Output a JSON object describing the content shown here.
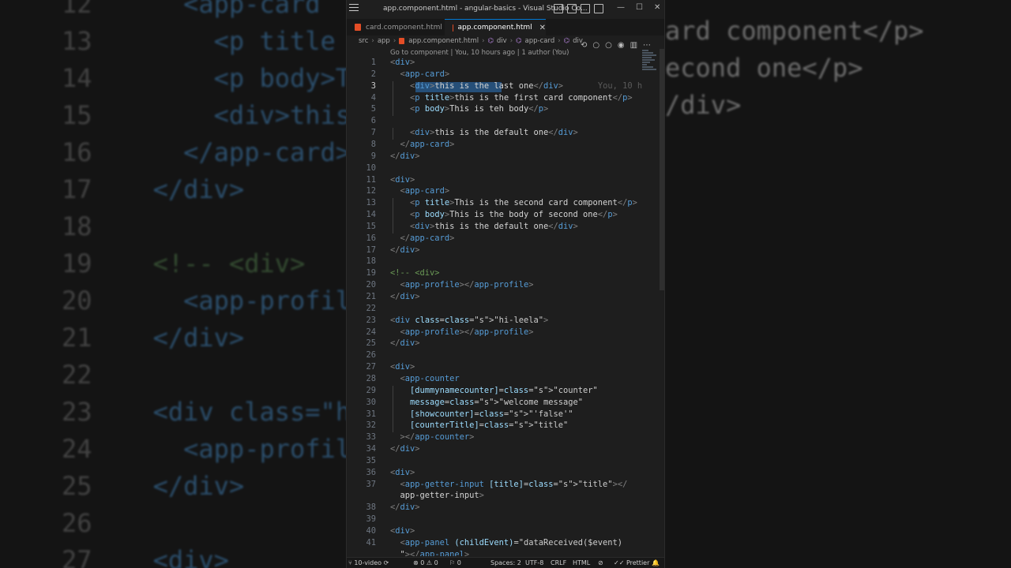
{
  "window": {
    "title": "app.component.html - angular-basics - Visual Studio Co..."
  },
  "tabs": [
    {
      "label": "card.component.html",
      "active": false
    },
    {
      "label": "app.component.html",
      "active": true
    }
  ],
  "breadcrumb": [
    "src",
    "app",
    "app.component.html",
    "div",
    "app-card",
    "div"
  ],
  "codelens": "Go to component | You, 10 hours ago | 1 author (You)",
  "blame": "You, 10 h",
  "lines": [
    {
      "n": "1",
      "code": "<div>"
    },
    {
      "n": "2",
      "code": "  <app-card>"
    },
    {
      "n": "3",
      "code": "    <div>this is the last one</div>"
    },
    {
      "n": "4",
      "code": "    <p title>this is the first card component</p>"
    },
    {
      "n": "5",
      "code": "    <p body>This is teh body</p>"
    },
    {
      "n": "6",
      "code": ""
    },
    {
      "n": "7",
      "code": "    <div>this is the default one</div>"
    },
    {
      "n": "8",
      "code": "  </app-card>"
    },
    {
      "n": "9",
      "code": "</div>"
    },
    {
      "n": "10",
      "code": ""
    },
    {
      "n": "11",
      "code": "<div>"
    },
    {
      "n": "12",
      "code": "  <app-card>"
    },
    {
      "n": "13",
      "code": "    <p title>This is the second card component</p>"
    },
    {
      "n": "14",
      "code": "    <p body>This is the body of second one</p>"
    },
    {
      "n": "15",
      "code": "    <div>this is the default one</div>"
    },
    {
      "n": "16",
      "code": "  </app-card>"
    },
    {
      "n": "17",
      "code": "</div>"
    },
    {
      "n": "18",
      "code": ""
    },
    {
      "n": "19",
      "code": "<!-- <div>"
    },
    {
      "n": "20",
      "code": "  <app-profile></app-profile>"
    },
    {
      "n": "21",
      "code": "</div>"
    },
    {
      "n": "22",
      "code": ""
    },
    {
      "n": "23",
      "code": "<div class=\"hi-leela\">"
    },
    {
      "n": "24",
      "code": "  <app-profile></app-profile>"
    },
    {
      "n": "25",
      "code": "</div>"
    },
    {
      "n": "26",
      "code": ""
    },
    {
      "n": "27",
      "code": "<div>"
    },
    {
      "n": "28",
      "code": "  <app-counter"
    },
    {
      "n": "29",
      "code": "    [dummynamecounter]=\"counter\""
    },
    {
      "n": "30",
      "code": "    message=\"welcome message\""
    },
    {
      "n": "31",
      "code": "    [showcounter]=\"'false'\""
    },
    {
      "n": "32",
      "code": "    [counterTitle]=\"title\""
    },
    {
      "n": "33",
      "code": "  ></app-counter>"
    },
    {
      "n": "34",
      "code": "</div>"
    },
    {
      "n": "35",
      "code": ""
    },
    {
      "n": "36",
      "code": "<div>"
    },
    {
      "n": "37",
      "code": "  <app-getter-input [title]=\"title\"></"
    },
    {
      "n": "",
      "code": "  app-getter-input>"
    },
    {
      "n": "38",
      "code": "</div>"
    },
    {
      "n": "39",
      "code": ""
    },
    {
      "n": "40",
      "code": "<div>"
    },
    {
      "n": "41",
      "code": "  <app-panel (childEvent)=\"dataReceived($event)"
    },
    {
      "n": "",
      "code": "  \"></app-panel>"
    }
  ],
  "status": {
    "branch": "10-video",
    "errors": "0",
    "warnings": "0",
    "info": "0",
    "spaces": "Spaces: 2",
    "encoding": "UTF-8",
    "eol": "CRLF",
    "language": "HTML",
    "prettier": "Prettier"
  },
  "background": {
    "left": [
      {
        "n": "12",
        "code": "    <app-card"
      },
      {
        "n": "13",
        "code": "      <p title"
      },
      {
        "n": "14",
        "code": "      <p body>Th"
      },
      {
        "n": "15",
        "code": "      <div>this"
      },
      {
        "n": "16",
        "code": "    </app-card>"
      },
      {
        "n": "17",
        "code": "  </div>"
      },
      {
        "n": "18",
        "code": ""
      },
      {
        "n": "19",
        "code": "  <!-- <div>"
      },
      {
        "n": "20",
        "code": "    <app-profile"
      },
      {
        "n": "21",
        "code": "  </div>"
      },
      {
        "n": "22",
        "code": ""
      },
      {
        "n": "23",
        "code": "  <div class=\"h"
      },
      {
        "n": "24",
        "code": "    <app-profile"
      },
      {
        "n": "25",
        "code": "  </div>"
      },
      {
        "n": "26",
        "code": ""
      },
      {
        "n": "27",
        "code": "  <div>"
      }
    ],
    "right": [
      "ard component</p>",
      "econd one</p>",
      "/div>"
    ]
  }
}
